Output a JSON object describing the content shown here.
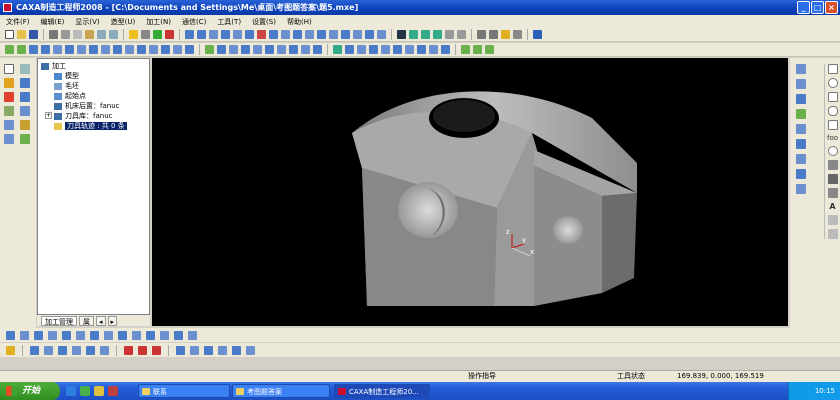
{
  "window": {
    "title": "CAXA制造工程师2008  - [C:\\Documents and Settings\\Me\\桌面\\考图题答案\\题5.mxe]"
  },
  "menu": [
    "文件(F)",
    "编辑(E)",
    "显示(V)",
    "造型(U)",
    "加工(N)",
    "通信(C)",
    "工具(T)",
    "设置(S)",
    "帮助(H)"
  ],
  "tree": {
    "root": "加工",
    "items": [
      {
        "label": "模型",
        "note": ""
      },
      {
        "label": "毛坯",
        "note": ""
      },
      {
        "label": "起始点",
        "note": ""
      },
      {
        "label": "机床后置",
        "note": "：fanuc"
      },
      {
        "label": "刀具库",
        "note": "：fanuc"
      }
    ],
    "selected": "刀具轨迹 : 共 0 条",
    "tabs": [
      "加工管理",
      "属"
    ]
  },
  "axes": {
    "z": "z",
    "y": "y",
    "x": "x"
  },
  "right_panel": {
    "label_foo": "foo",
    "label_a": "A"
  },
  "status": {
    "prompt": "操作指导",
    "state": "工具状态",
    "coords": "169.839, 0.000, 169.519"
  },
  "taskbar": {
    "start": "开始",
    "tasks": [
      "联系",
      "考图题答案",
      "CAXA制造工程师20..."
    ],
    "clock": "10:15"
  },
  "colors": {
    "titlebar": "#0b3aa6",
    "viewport": "#000000",
    "selection": "#0a246a",
    "start": "#2f8e1f"
  }
}
